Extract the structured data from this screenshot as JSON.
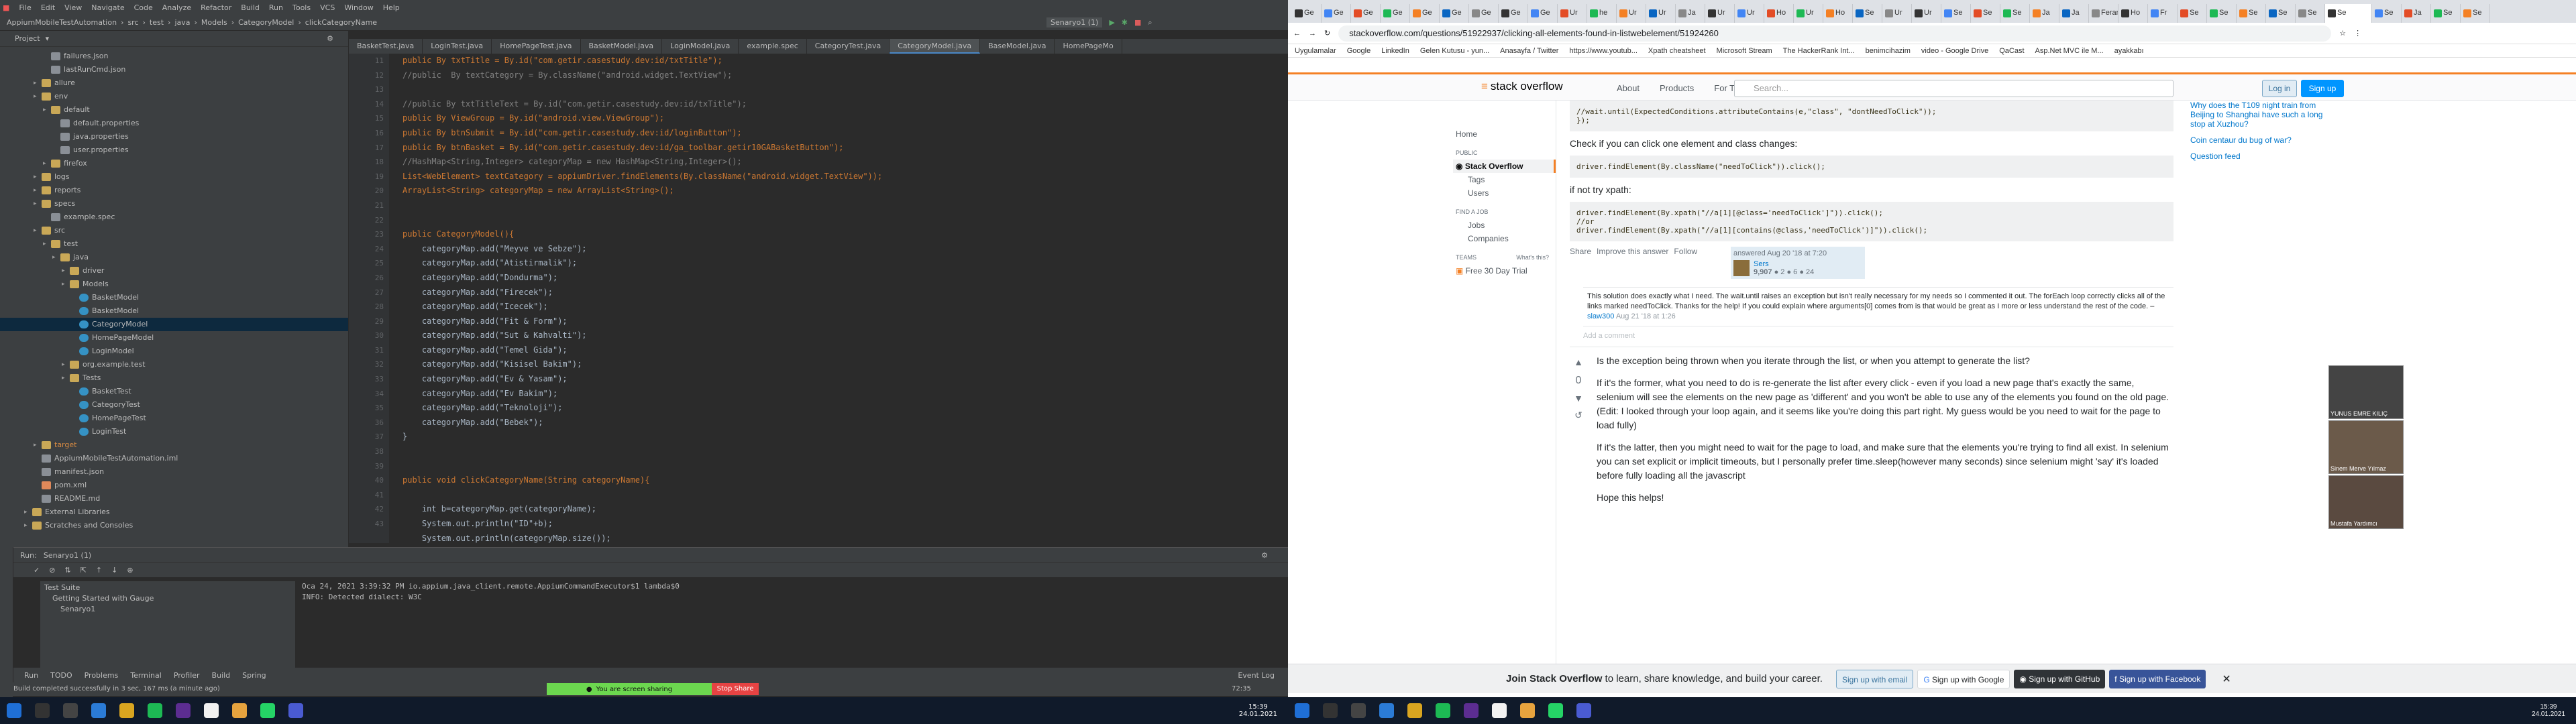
{
  "ide": {
    "menu": [
      "File",
      "Edit",
      "View",
      "Navigate",
      "Code",
      "Analyze",
      "Refactor",
      "Build",
      "Run",
      "Tools",
      "VCS",
      "Window",
      "Help"
    ],
    "window_title": "AppiumMobileTestAutomation - CategoryModel.java",
    "breadcrumbs": [
      "AppiumMobileTestAutomation",
      "src",
      "test",
      "java",
      "Models",
      "CategoryModel",
      "clickCategoryName"
    ],
    "run_config": "Senaryo1 (1)",
    "project_label": "Project",
    "tree": [
      {
        "label": "failures.json",
        "icon": "file",
        "d": 3
      },
      {
        "label": "lastRunCmd.json",
        "icon": "file",
        "d": 3
      },
      {
        "label": "allure",
        "icon": "fold",
        "d": 2
      },
      {
        "label": "env",
        "icon": "fold",
        "d": 2
      },
      {
        "label": "default",
        "icon": "fold",
        "d": 3
      },
      {
        "label": "default.properties",
        "icon": "file",
        "d": 4
      },
      {
        "label": "java.properties",
        "icon": "file",
        "d": 4
      },
      {
        "label": "user.properties",
        "icon": "file",
        "d": 4
      },
      {
        "label": "firefox",
        "icon": "fold",
        "d": 3
      },
      {
        "label": "logs",
        "icon": "fold",
        "d": 2
      },
      {
        "label": "reports",
        "icon": "fold",
        "d": 2
      },
      {
        "label": "specs",
        "icon": "fold",
        "d": 2
      },
      {
        "label": "example.spec",
        "icon": "file",
        "d": 3
      },
      {
        "label": "src",
        "icon": "fold",
        "d": 2
      },
      {
        "label": "test",
        "icon": "fold",
        "d": 3
      },
      {
        "label": "java",
        "icon": "fold",
        "d": 4
      },
      {
        "label": "driver",
        "icon": "fold",
        "d": 5
      },
      {
        "label": "Models",
        "icon": "fold",
        "d": 5
      },
      {
        "label": "BasketModel",
        "icon": "cls",
        "d": 6
      },
      {
        "label": "BasketModel",
        "icon": "cls",
        "d": 6
      },
      {
        "label": "CategoryModel",
        "icon": "cls",
        "d": 6,
        "sel": true
      },
      {
        "label": "HomePageModel",
        "icon": "cls",
        "d": 6
      },
      {
        "label": "LoginModel",
        "icon": "cls",
        "d": 6
      },
      {
        "label": "org.example.test",
        "icon": "fold",
        "d": 5
      },
      {
        "label": "Tests",
        "icon": "fold",
        "d": 5
      },
      {
        "label": "BasketTest",
        "icon": "cls",
        "d": 6
      },
      {
        "label": "CategoryTest",
        "icon": "cls",
        "d": 6
      },
      {
        "label": "HomePageTest",
        "icon": "cls",
        "d": 6
      },
      {
        "label": "LoginTest",
        "icon": "cls",
        "d": 6
      },
      {
        "label": "target",
        "icon": "fold",
        "d": 2,
        "orange": true
      },
      {
        "label": "AppiumMobileTestAutomation.iml",
        "icon": "file",
        "d": 2
      },
      {
        "label": "manifest.json",
        "icon": "file",
        "d": 2
      },
      {
        "label": "pom.xml",
        "icon": "xml",
        "d": 2
      },
      {
        "label": "README.md",
        "icon": "file",
        "d": 2
      },
      {
        "label": "External Libraries",
        "icon": "fold",
        "d": 1
      },
      {
        "label": "Scratches and Consoles",
        "icon": "fold",
        "d": 1
      }
    ],
    "tabs": [
      "BasketTest.java",
      "LoginTest.java",
      "HomePageTest.java",
      "BasketModel.java",
      "LoginModel.java",
      "example.spec",
      "CategoryTest.java",
      "CategoryModel.java",
      "BaseModel.java",
      "HomePageMo"
    ],
    "active_tab": "CategoryModel.java",
    "line_numbers": [
      "11",
      "12",
      "13",
      "14",
      "15",
      "16",
      "17",
      "18",
      "19",
      "20",
      "21",
      "22",
      "23",
      "24",
      "25",
      "26",
      "27",
      "28",
      "29",
      "30",
      "31",
      "32",
      "33",
      "34",
      "35",
      "36",
      "37",
      "38",
      "39",
      "40",
      "41",
      "42",
      "43"
    ],
    "code": [
      "public By txtTitle = By.id(\"com.getir.casestudy.dev:id/txtTitle\");",
      "//public  By textCategory = By.className(\"android.widget.TextView\");",
      "",
      "//public By txtTitleText = By.id(\"com.getir.casestudy.dev:id/txTitle\");",
      "public By ViewGroup = By.id(\"android.view.ViewGroup\");",
      "public By btnSubmit = By.id(\"com.getir.casestudy.dev:id/loginButton\");",
      "public By btnBasket = By.id(\"com.getir.casestudy.dev:id/ga_toolbar.getir10GABasketButton\");",
      "//HashMap<String,Integer> categoryMap = new HashMap<String,Integer>();",
      "List<WebElement> textCategory = appiumDriver.findElements(By.className(\"android.widget.TextView\"));",
      "ArrayList<String> categoryMap = new ArrayList<String>();",
      "",
      "",
      "public CategoryModel(){",
      "    categoryMap.add(\"Meyve ve Sebze\");",
      "    categoryMap.add(\"Atistirmalik\");",
      "    categoryMap.add(\"Dondurma\");",
      "    categoryMap.add(\"Firecek\");",
      "    categoryMap.add(\"Icecek\");",
      "    categoryMap.add(\"Fit & Form\");",
      "    categoryMap.add(\"Sut & Kahvalti\");",
      "    categoryMap.add(\"Temel Gida\");",
      "    categoryMap.add(\"Kisisel Bakim\");",
      "    categoryMap.add(\"Ev & Yasam\");",
      "    categoryMap.add(\"Ev Bakim\");",
      "    categoryMap.add(\"Teknoloji\");",
      "    categoryMap.add(\"Bebek\");",
      "}",
      "",
      "",
      "public void clickCategoryName(String categoryName){",
      "",
      "    int b=categoryMap.get(categoryName);",
      "    System.out.println(\"ID\"+b);",
      "    System.out.println(categoryMap.size());",
      "    System.out.println();"
    ],
    "run_label": "Run:",
    "run_config_tab": "Senaryo1 (1)",
    "test_tree": [
      "Test Suite",
      "Getting Started with Gauge",
      "Senaryo1"
    ],
    "console": [
      "Oca 24, 2021 3:39:32 PM io.appium.java_client.remote.AppiumCommandExecutor$1 lambda$0",
      "INFO: Detected dialect: W3C"
    ],
    "bottom_tabs": [
      "Run",
      "TODO",
      "Problems",
      "Terminal",
      "Profiler",
      "Build",
      "Spring"
    ],
    "event_log": "Event Log",
    "status": "Build completed successfully in 3 sec, 167 ms (a minute ago)",
    "position": "72:35",
    "sharing": "You are screen sharing",
    "stop_share": "Stop Share",
    "clock": "15:39",
    "date": "24.01.2021"
  },
  "browser": {
    "tabs": [
      "Ge",
      "Ge",
      "Ge",
      "Ge",
      "Ge",
      "Ge",
      "Ge",
      "Ge",
      "Ge",
      "Ur",
      "he",
      "Ur",
      "Ur",
      "Ja",
      "Ur",
      "Ur",
      "Ho",
      "Ur",
      "Ho",
      "Se",
      "Ur",
      "Ur",
      "Se",
      "Se",
      "Se",
      "Ja",
      "Ja",
      "Ferari",
      "Ho",
      "Fr",
      "Se",
      "Se",
      "Se",
      "Se",
      "Se",
      "Se",
      "Se",
      "Ja",
      "Se",
      "Se"
    ],
    "url": "stackoverflow.com/questions/51922937/clicking-all-elements-found-in-listwebelement/51924260",
    "bookmarks": [
      "Uygulamalar",
      "Google",
      "LinkedIn",
      "Gelen Kutusu - yun...",
      "Anasayfa / Twitter",
      "https://www.youtub...",
      "Xpath cheatsheet",
      "Microsoft Stream",
      "The HackerRank Int...",
      "benimcihazim",
      "video - Google Drive",
      "QaCast",
      "Asp.Net MVC ile M...",
      "ayakkabı"
    ],
    "so": {
      "logo": "stack overflow",
      "nav": [
        "About",
        "Products",
        "For Teams"
      ],
      "search_placeholder": "Search...",
      "login": "Log in",
      "signup": "Sign up",
      "left": {
        "home": "Home",
        "public": "PUBLIC",
        "so": "Stack Overflow",
        "tags": "Tags",
        "users": "Users",
        "find_job": "FIND A JOB",
        "jobs": "Jobs",
        "companies": "Companies",
        "teams": "TEAMS",
        "whats_this": "What's this?",
        "free_trial": "Free 30 Day Trial"
      },
      "code_top": "//wait.until(ExpectedConditions.attributeContains(e,\"class\", \"dontNeedToClick\"));\n});",
      "p1": "Check if you can click one element and class changes:",
      "code1": "driver.findElement(By.className(\"needToClick\")).click();",
      "p2": "if not try xpath:",
      "code2": "driver.findElement(By.xpath(\"//a[1][@class='needToClick']\")).click();\n//or\ndriver.findElement(By.xpath(\"//a[1][contains(@class,'needToClick')]\")).click();",
      "share": "Share",
      "improve": "Improve this answer",
      "follow": "Follow",
      "answered": "answered Aug 20 '18 at 7:20",
      "user": "Sers",
      "rep": "9,907",
      "badges": "● 2 ● 6 ● 24",
      "comment": "This solution does exactly what I need. The wait.until raises an exception but isn't really necessary for my needs so I commented it out. The forEach loop correctly clicks all of the links marked needToClick. Thanks for the help! If you could explain where arguments[0] comes from is that would be great as I more or less understand the rest of the code. – ",
      "comment_user": "slaw300",
      "comment_date": "Aug 21 '18 at 1:26",
      "add_comment": "Add a comment",
      "vote": "0",
      "a2p1": "Is the exception being thrown when you iterate through the list, or when you attempt to generate the list?",
      "a2p2": "If it's the former, what you need to do is re-generate the list after every click - even if you load a new page that's exactly the same, selenium will see the elements on the new page as 'different' and you won't be able to use any of the elements you found on the old page. (Edit: I looked through your loop again, and it seems like you're doing this part right. My guess would be you need to wait for the page to load fully)",
      "a2p3": "If it's the latter, then you might need to wait for the page to load, and make sure that the elements you're trying to find all exist. In selenium you can set explicit or implicit timeouts, but I personally prefer time.sleep(however many seconds) since selenium might 'say' it's loaded before fully loading all the javascript",
      "a2p4": "Hope this helps!",
      "hot": [
        "Why does the T109 night train from Beijing to Shanghai have such a long stop at Xuzhou?",
        "Coin centaur du bug of war?",
        "Question feed"
      ],
      "banner": {
        "title": "Join Stack Overflow",
        "text": " to learn, share knowledge, and build your career.",
        "email": "Sign up with email",
        "google": "Sign up with Google",
        "github": "Sign up with GitHub",
        "facebook": "Sign up with Facebook"
      }
    },
    "participants": [
      "YUNUS EMRE KILIÇ",
      "Sinem Merve Yılmaz",
      "Mustafa Yardımcı"
    ],
    "clock": "15:39",
    "date": "24.01.2021"
  }
}
